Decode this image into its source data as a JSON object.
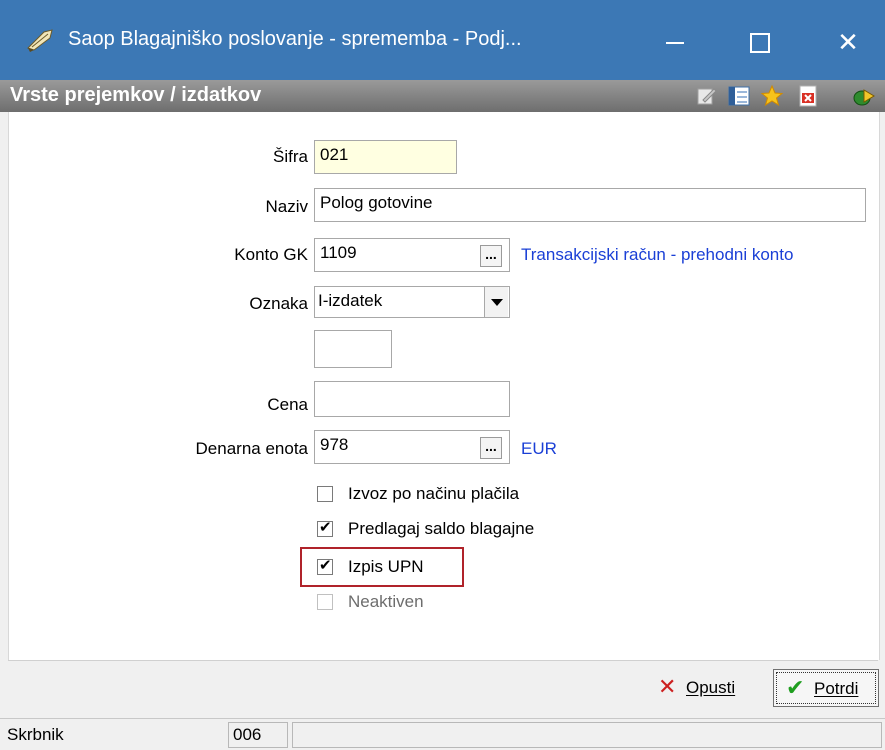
{
  "window": {
    "title": "Saop Blagajniško poslovanje - sprememba - Podj...",
    "icon": "feather-pen-icon"
  },
  "header": {
    "heading": "Vrste prejemkov / izdatkov",
    "tools": [
      "edit-icon",
      "columns-icon",
      "favorite-star-icon",
      "pdf-icon",
      "exit-icon"
    ]
  },
  "form": {
    "sifra": {
      "label": "Šifra",
      "value": "021"
    },
    "naziv": {
      "label": "Naziv",
      "value": "Polog gotovine"
    },
    "konto": {
      "label": "Konto GK",
      "value": "1109",
      "lookup": "...",
      "desc": "Transakcijski račun - prehodni konto"
    },
    "oznaka": {
      "label": "Oznaka",
      "value": "I-izdatek"
    },
    "extra": {
      "value": ""
    },
    "cena": {
      "label": "Cena",
      "value": ""
    },
    "enota": {
      "label": "Denarna enota",
      "value": "978",
      "lookup": "...",
      "desc": "EUR"
    },
    "options": [
      {
        "label": "Izvoz po načinu plačila",
        "checked": false
      },
      {
        "label": "Predlagaj saldo blagajne",
        "checked": true
      },
      {
        "label": "Izpis UPN",
        "checked": true
      },
      {
        "label": "Neaktiven",
        "checked": false
      }
    ]
  },
  "buttons": {
    "cancel": "Opusti",
    "confirm": "Potrdi"
  },
  "status": {
    "user": "Skrbnik",
    "code": "006"
  },
  "colors": {
    "titlebar": "#3c78b5",
    "link": "#1a3fd6",
    "highlight": "#b0232a",
    "required_field": "#ffffe1"
  }
}
